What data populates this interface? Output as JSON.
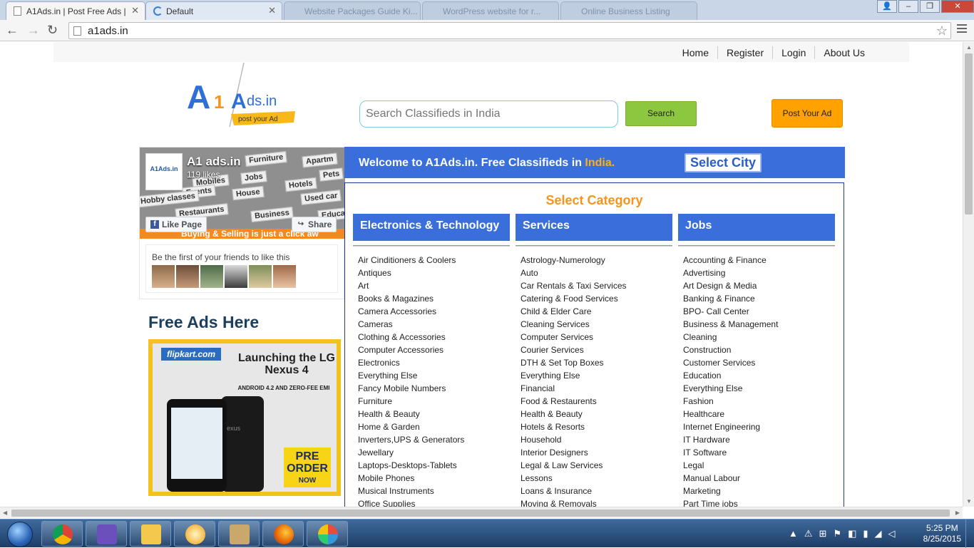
{
  "browser": {
    "tabs": [
      {
        "title": "A1Ads.in | Post Free Ads |",
        "active": true
      },
      {
        "title": "Default",
        "active": false
      },
      {
        "title": "",
        "active": false
      },
      {
        "title": "Website Packages Guide Ki...",
        "active": false
      },
      {
        "title": "WordPress website for r...",
        "active": false
      },
      {
        "title": "Online Business Listing",
        "active": false
      }
    ],
    "url": "a1ads.in"
  },
  "site": {
    "nav": [
      "Home",
      "Register",
      "Login",
      "About Us"
    ],
    "logo_text": "A1Ads.in",
    "logo_tagline": "post your Ad",
    "search_placeholder": "Search Classifieds in India",
    "search_button": "Search",
    "post_button": "Post Your Ad",
    "facebook": {
      "page_name": "A1 ads.in",
      "likes": "119 likes",
      "like_button": "Like Page",
      "share_button": "Share",
      "friends_text": "Be the first of your friends to like this",
      "cover_words": [
        "Furniture",
        "Apartm",
        "Jobs",
        "Pets",
        "Mobiles",
        "Hotels",
        "House",
        "Events",
        "Hobby classes",
        "Used car",
        "Restaurants",
        "Business",
        "Educa"
      ],
      "cover_banner": "Buying & Selling is just a click aw"
    },
    "free_ads_heading": "Free Ads Here",
    "ad": {
      "brand": "flipkart.com",
      "headline": "Launching the LG Nexus 4",
      "sub": "ANDROID 4.2 AND ZERO-FEE EMI",
      "phone_brand": "exus",
      "cta_line1": "PRE",
      "cta_line2": "ORDER",
      "cta_line3": "NOW"
    },
    "welcome_prefix": "Welcome to A1Ads.in. Free Classifieds in ",
    "welcome_highlight": "India.",
    "select_city": "Select City",
    "select_category": "Select Category",
    "columns": [
      {
        "heading": "Electronics & Technology",
        "items": [
          "Air Cinditioners & Coolers",
          "Antiques",
          "Art",
          "Books & Magazines",
          "Camera Accessories",
          "Cameras",
          "Clothing & Accessories",
          "Computer Accessories",
          "Electronics",
          "Everything Else",
          "Fancy Mobile Numbers",
          "Furniture",
          "Health & Beauty",
          "Home & Garden",
          "Inverters,UPS & Generators",
          "Jewellary",
          "Laptops-Desktops-Tablets",
          "Mobile Phones",
          "Musical Instruments",
          "Office Supplies"
        ]
      },
      {
        "heading": "Services",
        "items": [
          "Astrology-Numerology",
          "Auto",
          "Car Rentals & Taxi Services",
          "Catering & Food Services",
          "Child & Elder Care",
          "Cleaning Services",
          "Computer Services",
          "Courier Services",
          "DTH & Set Top Boxes",
          "Everything Else",
          "Financial",
          "Food & Restaurents",
          "Health & Beauty",
          "Hotels & Resorts",
          "Household",
          "Interior Designers",
          "Legal & Law Services",
          "Lessons",
          "Loans & Insurance",
          "Moving & Removals"
        ]
      },
      {
        "heading": "Jobs",
        "items": [
          "Accounting & Finance",
          "Advertising",
          "Art Design & Media",
          "Banking & Finance",
          "BPO- Call Center",
          "Business & Management",
          "Cleaning",
          "Construction",
          "Customer Services",
          "Education",
          "Everything Else",
          "Fashion",
          "Healthcare",
          "Internet Engineering",
          "IT Hardware",
          "IT Software",
          "Legal",
          "Manual Labour",
          "Marketing",
          "Part Time jobs"
        ]
      }
    ]
  },
  "taskbar": {
    "apps": [
      "chrome-icon",
      "visual-studio-icon",
      "file-explorer-icon",
      "media-player-icon",
      "tools-icon",
      "firefox-icon",
      "paint-icon"
    ],
    "time": "5:25 PM",
    "date": "8/25/2015"
  },
  "colors": {
    "accent_blue": "#3a6fdb",
    "orange": "#f7941d",
    "search_green": "#8dc63f",
    "post_orange": "#ffa200"
  }
}
